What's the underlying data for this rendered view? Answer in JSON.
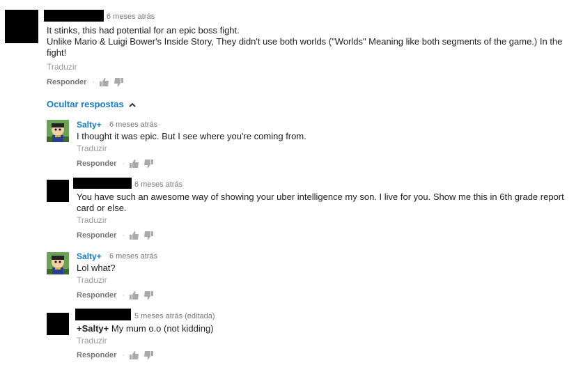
{
  "comment": {
    "time": "6 meses atrás",
    "line1": "It stinks, this had potential for an epic boss fight.",
    "line2": "Unlike Mario & Luigi Bower's Inside Story, They didn't use both worlds (\"Worlds\" Meaning like both segments of the game.) In the fight!",
    "translate": "Traduzir",
    "reply": "Responder"
  },
  "hide_replies": "Ocultar respostas",
  "replies": [
    {
      "author": "Salty+",
      "time": "6 meses atrás",
      "text": "I thought it was epic. But I see where you're coming from.",
      "translate": "Traduzir",
      "reply": "Responder"
    },
    {
      "author": "",
      "time": "6 meses atrás",
      "text": "You have such an awesome way of showing your uber intelligence my son. I live for you. Show me this in 6th grade report card or else.",
      "translate": "Traduzir",
      "reply": "Responder"
    },
    {
      "author": "Salty+",
      "time": "6 meses atrás",
      "text": "Lol what?",
      "translate": "Traduzir",
      "reply": "Responder"
    },
    {
      "author": "",
      "time": "5 meses atrás (editada)",
      "mention": "+Salty+",
      "text": " My mum o.o (not kidding)",
      "translate": "Traduzir",
      "reply": "Responder"
    }
  ],
  "colors": {
    "link": "#167ac6",
    "meta": "#767676",
    "translate": "#999999"
  },
  "icons": [
    "thumb-up-icon",
    "thumb-down-icon",
    "chevron-up-icon"
  ]
}
